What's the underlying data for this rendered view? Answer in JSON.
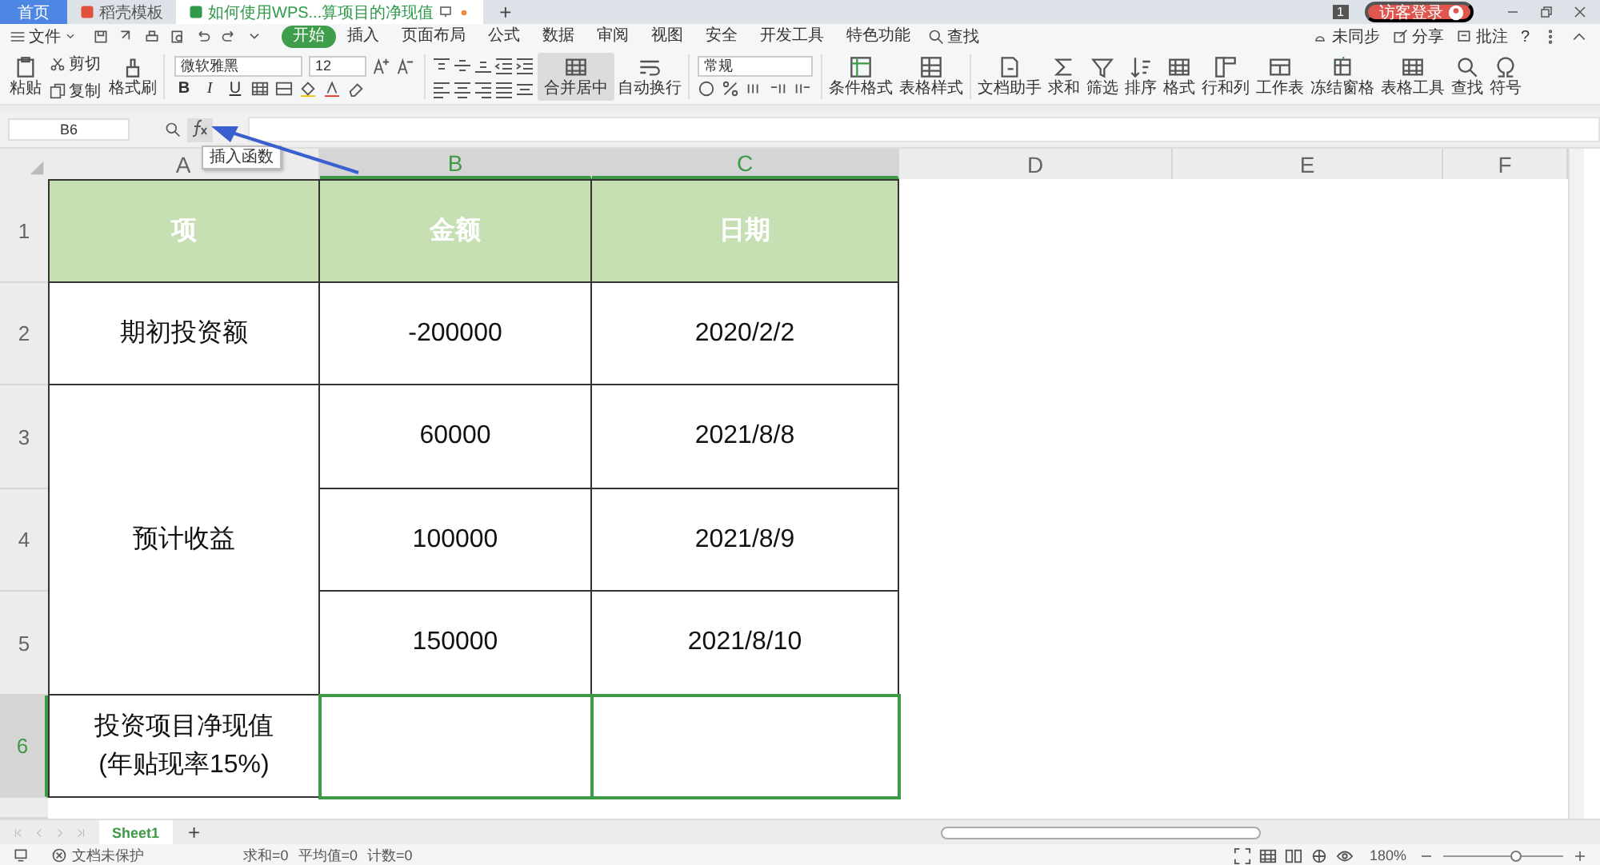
{
  "title_bar": {
    "tabs": [
      {
        "label": "首页",
        "selected": false
      },
      {
        "label": "稻壳模板",
        "selected": false
      },
      {
        "label": "如何使用WPS...算项目的净现值",
        "selected": true
      }
    ],
    "new_tab": "+",
    "badge": "1",
    "login": "访客登录"
  },
  "menu_bar": {
    "file": "文件",
    "tabs": [
      {
        "label": "开始",
        "selected": true
      },
      {
        "label": "插入",
        "selected": false
      },
      {
        "label": "页面布局",
        "selected": false
      },
      {
        "label": "公式",
        "selected": false
      },
      {
        "label": "数据",
        "selected": false
      },
      {
        "label": "审阅",
        "selected": false
      },
      {
        "label": "视图",
        "selected": false
      },
      {
        "label": "安全",
        "selected": false
      },
      {
        "label": "开发工具",
        "selected": false
      },
      {
        "label": "特色功能",
        "selected": false
      }
    ],
    "search": "查找",
    "actions": [
      "未同步",
      "分享",
      "批注"
    ],
    "help": "?"
  },
  "toolbar": {
    "paste": "粘贴",
    "cut": "剪切",
    "copy": "复制",
    "format_painter": "格式刷",
    "font": "微软雅黑",
    "font_size": "12",
    "bold": "B",
    "italic": "I",
    "underline": "U",
    "merge": "合并居中",
    "wrap": "自动换行",
    "number_format": "常规",
    "tools": [
      "条件格式",
      "表格样式",
      "文档助手",
      "求和",
      "筛选",
      "排序",
      "格式",
      "行和列",
      "工作表",
      "冻结窗格",
      "表格工具",
      "查找",
      "符号"
    ]
  },
  "formula_bar": {
    "name_box": "B6",
    "tooltip": "插入函数"
  },
  "sheet": {
    "columns": [
      {
        "label": "A",
        "selected": false
      },
      {
        "label": "B",
        "selected": true
      },
      {
        "label": "C",
        "selected": true
      },
      {
        "label": "D",
        "selected": false
      },
      {
        "label": "E",
        "selected": false
      },
      {
        "label": "F",
        "selected": false
      }
    ],
    "rows": [
      {
        "header": "1",
        "selected": false,
        "kind": "header",
        "cells": [
          {
            "text": "项",
            "selected": false
          },
          {
            "text": "金额",
            "selected": false
          },
          {
            "text": "日期",
            "selected": false
          }
        ]
      },
      {
        "header": "2",
        "selected": false,
        "kind": "body",
        "cells": [
          {
            "text": "期初投资额",
            "selected": false
          },
          {
            "text": "-200000",
            "selected": false
          },
          {
            "text": "2020/2/2",
            "selected": false
          }
        ]
      },
      {
        "header": "3",
        "selected": false,
        "kind": "body",
        "cells": [
          {
            "selected": false,
            "merged": true
          },
          {
            "text": "60000",
            "selected": false
          },
          {
            "text": "2021/8/8",
            "selected": false
          }
        ]
      },
      {
        "header": "4",
        "selected": false,
        "kind": "body",
        "cells": [
          {
            "text": "预计收益",
            "selected": false,
            "merged": true
          },
          {
            "text": "100000",
            "selected": false
          },
          {
            "text": "2021/8/9",
            "selected": false
          }
        ]
      },
      {
        "header": "5",
        "selected": false,
        "kind": "body",
        "cells": [
          {
            "selected": false,
            "merged": true
          },
          {
            "text": "150000",
            "selected": false
          },
          {
            "text": "2021/8/10",
            "selected": false
          }
        ]
      },
      {
        "header": "6",
        "selected": true,
        "kind": "body",
        "cells": [
          {
            "text": "投资项目净现值\n(年贴现率15%)",
            "selected": false
          },
          {
            "selected": true
          },
          {
            "selected": true
          }
        ]
      }
    ]
  },
  "sheet_tabs": {
    "tabs": [
      {
        "label": "Sheet1",
        "selected": true
      }
    ],
    "new_sheet": "+"
  },
  "status_bar": {
    "protection": "文档未保护",
    "stats": [
      "求和=0",
      "平均值=0",
      "计数=0"
    ],
    "zoom": "180%",
    "zoom_slider": {
      "level": 0.6
    }
  }
}
